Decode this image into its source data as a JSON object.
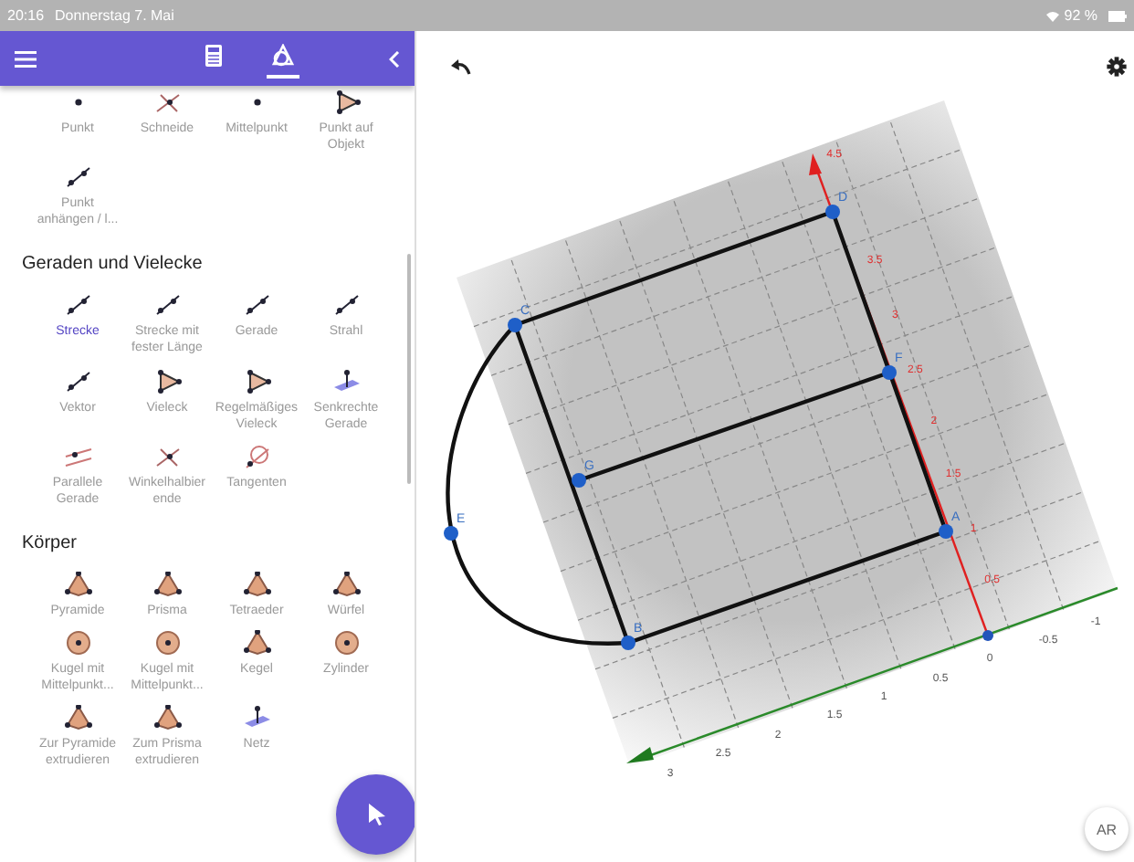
{
  "status_bar": {
    "time": "20:16",
    "date": "Donnerstag 7. Mai",
    "battery": "92 %"
  },
  "header": {
    "tabs": [
      {
        "kind": "calculator",
        "selected": false
      },
      {
        "kind": "geometry",
        "selected": true
      }
    ]
  },
  "tool_sections": [
    {
      "tools": [
        {
          "label": "Punkt",
          "kind": "point",
          "selected": false
        },
        {
          "label": "Schneide",
          "kind": "cross",
          "selected": false
        },
        {
          "label": "Mittelpunkt",
          "kind": "point",
          "selected": false
        },
        {
          "label": "Punkt auf Objekt",
          "kind": "polygon",
          "selected": false
        },
        {
          "label": "Punkt anhängen / l...",
          "kind": "line",
          "selected": false
        }
      ]
    },
    {
      "heading": "Geraden und Vielecke",
      "tools": [
        {
          "label": "Strecke",
          "kind": "line",
          "selected": true
        },
        {
          "label": "Strecke mit fester Länge",
          "kind": "line",
          "selected": false
        },
        {
          "label": "Gerade",
          "kind": "line",
          "selected": false
        },
        {
          "label": "Strahl",
          "kind": "line",
          "selected": false
        },
        {
          "label": "Vektor",
          "kind": "line",
          "selected": false
        },
        {
          "label": "Vieleck",
          "kind": "polygon",
          "selected": false
        },
        {
          "label": "Regelmäßiges Vieleck",
          "kind": "polygon",
          "selected": false
        },
        {
          "label": "Senkrechte Gerade",
          "kind": "plane",
          "selected": false
        },
        {
          "label": "Parallele Gerade",
          "kind": "parallel",
          "selected": false
        },
        {
          "label": "Winkelhalbier ende",
          "kind": "cross",
          "selected": false
        },
        {
          "label": "Tangenten",
          "kind": "circle",
          "selected": false
        }
      ]
    },
    {
      "heading": "Körper",
      "tools": [
        {
          "label": "Pyramide",
          "kind": "solid",
          "selected": false
        },
        {
          "label": "Prisma",
          "kind": "solid",
          "selected": false
        },
        {
          "label": "Tetraeder",
          "kind": "solid",
          "selected": false
        },
        {
          "label": "Würfel",
          "kind": "solid",
          "selected": false
        },
        {
          "label": "Kugel mit Mittelpunkt...",
          "kind": "sphere",
          "selected": false
        },
        {
          "label": "Kugel mit Mittelpunkt...",
          "kind": "sphere",
          "selected": false
        },
        {
          "label": "Kegel",
          "kind": "solid",
          "selected": false
        },
        {
          "label": "Zylinder",
          "kind": "sphere",
          "selected": false
        },
        {
          "label": "Zur Pyramide extrudieren",
          "kind": "solid",
          "selected": false
        },
        {
          "label": "Zum Prisma extrudieren",
          "kind": "solid",
          "selected": false
        },
        {
          "label": "Netz",
          "kind": "plane",
          "selected": false
        }
      ]
    }
  ],
  "view": {
    "points": [
      {
        "label": "D"
      },
      {
        "label": "C"
      },
      {
        "label": "F"
      },
      {
        "label": "G"
      },
      {
        "label": "E"
      },
      {
        "label": "A"
      },
      {
        "label": "B"
      }
    ],
    "z_axis_labels": [
      "4.5",
      "3.5",
      "3",
      "2.5",
      "2",
      "1.5",
      "1",
      "0.5"
    ],
    "y_axis_labels": [
      "3",
      "2.5",
      "2",
      "1.5",
      "1",
      "0.5",
      "0",
      "-0.5",
      "-1"
    ]
  },
  "ar_button": "AR"
}
